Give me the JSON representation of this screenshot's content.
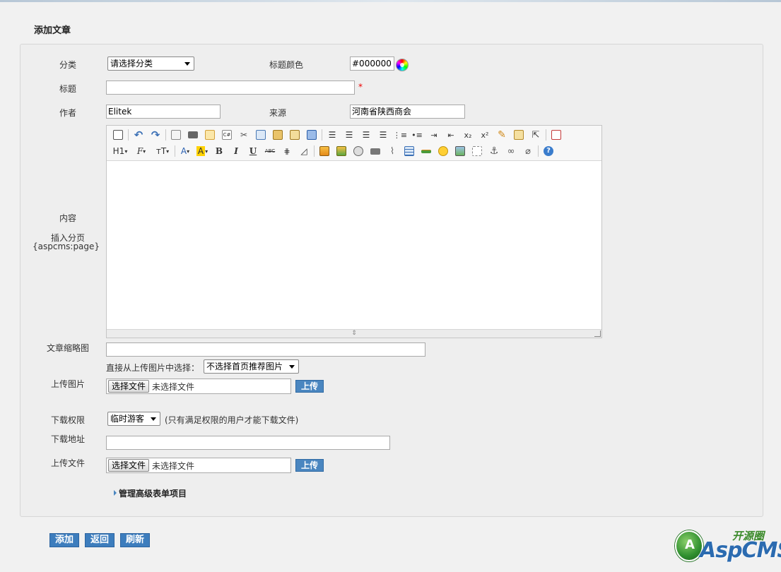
{
  "page_title": "添加文章",
  "form": {
    "category_label": "分类",
    "category_value": "请选择分类",
    "title_color_label": "标题颜色",
    "title_color_value": "#000000",
    "title_label": "标题",
    "title_value": "",
    "required_mark": "*",
    "author_label": "作者",
    "author_value": "Elitek",
    "source_label": "来源",
    "source_value": "河南省陕西商会",
    "content_label": "内容",
    "pagebreak_label": "插入分页",
    "pagebreak_tag": "{aspcms:page}",
    "thumb_label": "文章缩略图",
    "thumb_value": "",
    "pick_from_upload_label": "直接从上传图片中选择：",
    "pick_from_upload_value": "不选择首页推荐图片",
    "upload_image_label": "上传图片",
    "choose_file_label": "选择文件",
    "no_file_text": "未选择文件",
    "upload_button": "上传",
    "download_perm_label": "下载权限",
    "download_perm_value": "临时游客",
    "download_perm_note": "(只有满足权限的用户才能下载文件)",
    "download_url_label": "下载地址",
    "download_url_value": "",
    "upload_file_label": "上传文件",
    "advanced_label": "管理高级表单项目"
  },
  "editor": {
    "toolbar_row1": [
      "source-icon",
      "undo-icon",
      "redo-icon",
      "preview-icon",
      "print-icon",
      "template-icon",
      "code-icon",
      "cut-icon",
      "copy-icon",
      "paste-icon",
      "paste-text-icon",
      "paste-word-icon",
      "align-left-icon",
      "align-center-icon",
      "align-right-icon",
      "justify-icon",
      "ordered-list-icon",
      "unordered-list-icon",
      "indent-icon",
      "outdent-icon",
      "subscript-icon",
      "superscript-icon",
      "clear-format-icon",
      "select-all-icon",
      "pointer-icon",
      "fullscreen-icon"
    ],
    "toolbar_row2": [
      "heading-icon",
      "font-family-icon",
      "font-size-icon",
      "font-color-icon",
      "highlight-icon",
      "bold-icon",
      "italic-icon",
      "underline-icon",
      "strikethrough-icon",
      "line-height-icon",
      "eraser-icon",
      "image-icon",
      "multi-image-icon",
      "flash-icon",
      "media-icon",
      "attachment-icon",
      "table-icon",
      "hr-icon",
      "emoticon-icon",
      "map-icon",
      "pagebreak-icon",
      "anchor-icon",
      "link-icon",
      "unlink-icon",
      "help-icon"
    ],
    "heading_text": "H1",
    "font_family_text": "F",
    "font_size_text": "тT",
    "font_color_text": "A",
    "highlight_text": "A",
    "bold_text": "B",
    "italic_text": "I",
    "underline_text": "U",
    "strike_text": "ABC",
    "sub_text": "x₂",
    "sup_text": "x²",
    "help_text": "?"
  },
  "actions": {
    "add": "添加",
    "back": "返回",
    "refresh": "刷新"
  },
  "logo": {
    "top_text": "开源圈",
    "brand_text": "AspCMS"
  }
}
